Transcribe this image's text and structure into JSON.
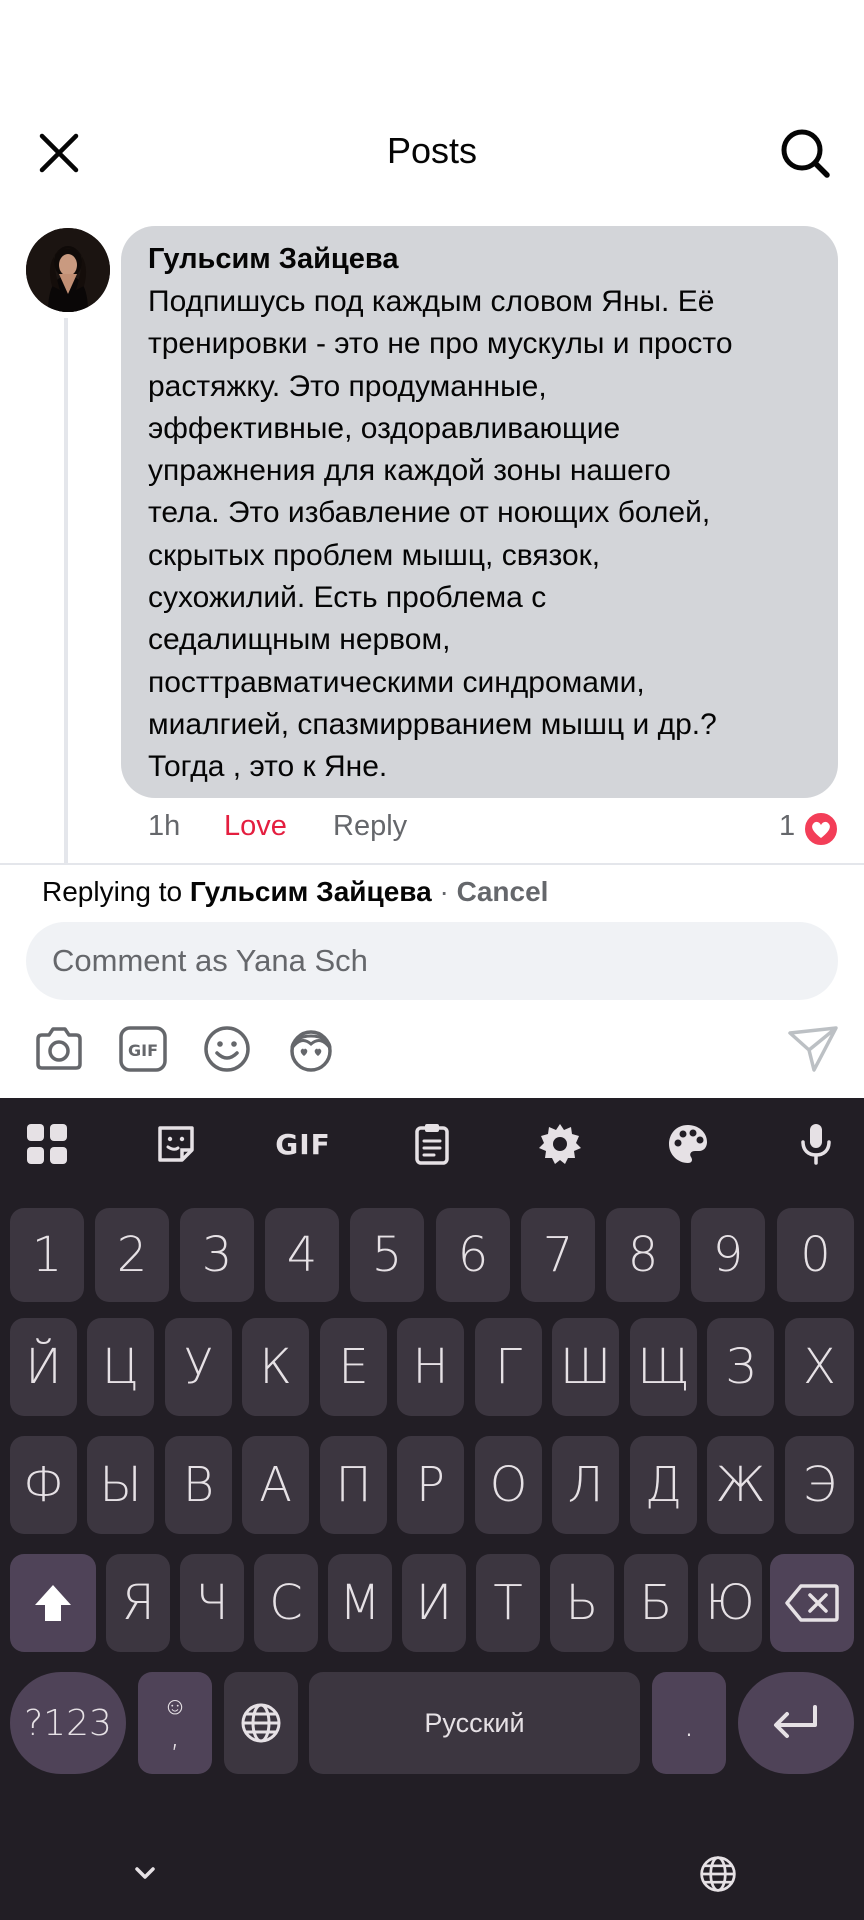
{
  "header": {
    "title": "Posts"
  },
  "comment": {
    "author": "Гульсим Зайцева",
    "lines": [
      "Подпишусь под каждым словом Яны. Её",
      "тренировки - это не про мускулы и просто",
      "растяжку. Это продуманные,",
      "эффективные, оздоравливающие",
      "упражнения для каждой зоны нашего",
      "тела. Это избавление от ноющих болей,",
      "скрытых проблем мышц, связок,",
      "сухожилий. Есть проблема с",
      "седалищным нервом,",
      "посттравматическими синдромами,",
      "миалгией, спазмиррванием мышц и др.?",
      "Тогда , это к Яне."
    ],
    "time": "1h",
    "love_label": "Love",
    "reply_label": "Reply",
    "reaction_count": "1"
  },
  "reply_bar": {
    "prefix": "Replying to",
    "name": "Гульсим Зайцева",
    "separator": "·",
    "cancel": "Cancel"
  },
  "composer": {
    "placeholder": "Comment as Yana Sch"
  },
  "composer_tools": [
    "camera-icon",
    "gif-icon",
    "emoji-icon",
    "avatar-sticker-icon",
    "send-icon"
  ],
  "keyboard": {
    "toolbar": {
      "gif": "GIF"
    },
    "rows": [
      [
        "1",
        "2",
        "3",
        "4",
        "5",
        "6",
        "7",
        "8",
        "9",
        "0"
      ],
      [
        "Й",
        "Ц",
        "У",
        "К",
        "Е",
        "Н",
        "Г",
        "Ш",
        "Щ",
        "З",
        "Х"
      ],
      [
        "Ф",
        "Ы",
        "В",
        "А",
        "П",
        "Р",
        "О",
        "Л",
        "Д",
        "Ж",
        "Э"
      ],
      [
        "Я",
        "Ч",
        "С",
        "М",
        "И",
        "Т",
        "Ь",
        "Б",
        "Ю"
      ]
    ],
    "symbols_key": "?123",
    "emoji_comma_top": "☺",
    "emoji_comma_bottom": ",",
    "space_label": "Русский",
    "period": "."
  },
  "colors": {
    "love": "#e41e3f",
    "bubble": "#d3d5d9",
    "keyboard_bg": "#221e25",
    "key": "#3c3640",
    "key_fn": "#4f4358"
  }
}
